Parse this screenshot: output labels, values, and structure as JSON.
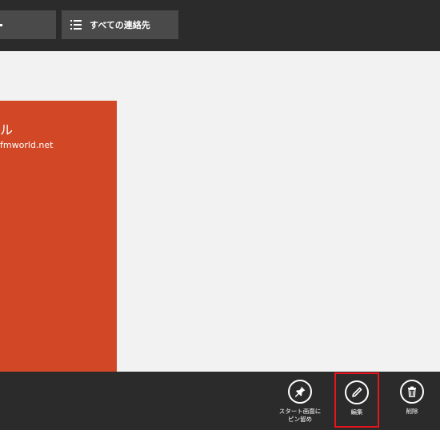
{
  "topbar": {
    "all_contacts_label": "すべての連絡先"
  },
  "contact": {
    "name": "ル",
    "email": "fmworld.net",
    "tile_color": "#d24726"
  },
  "appbar": {
    "pin_label_line1": "スタート画面に",
    "pin_label_line2": "ピン留め",
    "edit_label": "編集",
    "delete_label": "削除",
    "highlight_color": "#e8141c"
  },
  "icons": {
    "pin": "pin-icon",
    "edit": "pencil-icon",
    "delete": "trash-icon",
    "list": "list-icon"
  }
}
